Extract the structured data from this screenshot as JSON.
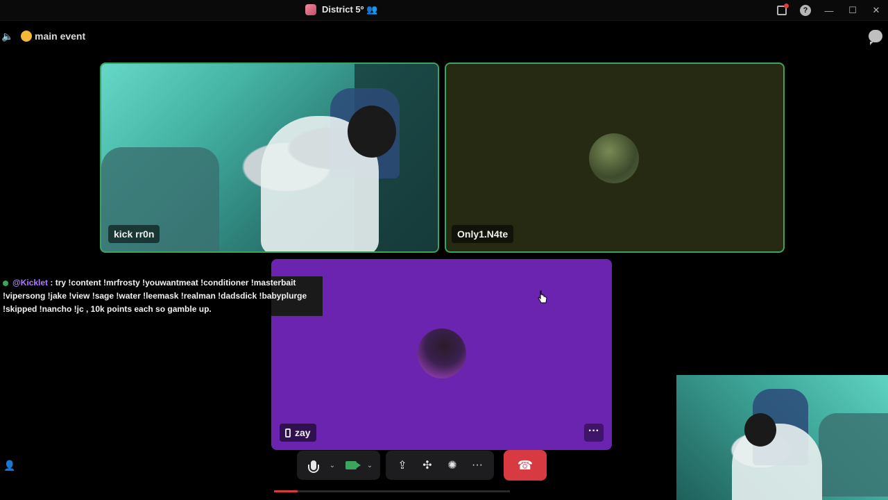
{
  "titlebar": {
    "server_name": "District 5º 👥",
    "icons": [
      "inbox-icon",
      "help-icon",
      "minimize-icon",
      "maximize-icon",
      "close-icon"
    ],
    "help_glyph": "?",
    "minimize_glyph": "—",
    "maximize_glyph": "☐",
    "close_glyph": "✕"
  },
  "channel": {
    "name": "main event",
    "speaker_glyph": "🔈"
  },
  "tiles": [
    {
      "name": "kick rr0n"
    },
    {
      "name": "Only1.N4te"
    },
    {
      "name": "zay",
      "more_glyph": "···"
    }
  ],
  "chat": {
    "user": "@Kicklet",
    "message_line1": " : try !content !mrfrosty !youwantmeat !conditioner !masterbait",
    "message_line2": "!vipersong !jake !view !sage !water !leemask !realman !dadsdick !babyplurge",
    "message_line3": "!skipped !nancho !jc , 10k points each so gamble up."
  },
  "controls": {
    "chevron_glyph": "⌄",
    "screen_share_glyph": "⇪",
    "activities_glyph": "✣",
    "soundboard_glyph": "✺",
    "more_glyph": "···",
    "end_call_glyph": "☎"
  },
  "progress": {
    "fraction": 0.1
  },
  "colors": {
    "accent_green": "#3ba55d",
    "end_call_red": "#d83a42",
    "zay_tile_purple": "#6b24b0",
    "mention_purple": "#b07aff"
  }
}
